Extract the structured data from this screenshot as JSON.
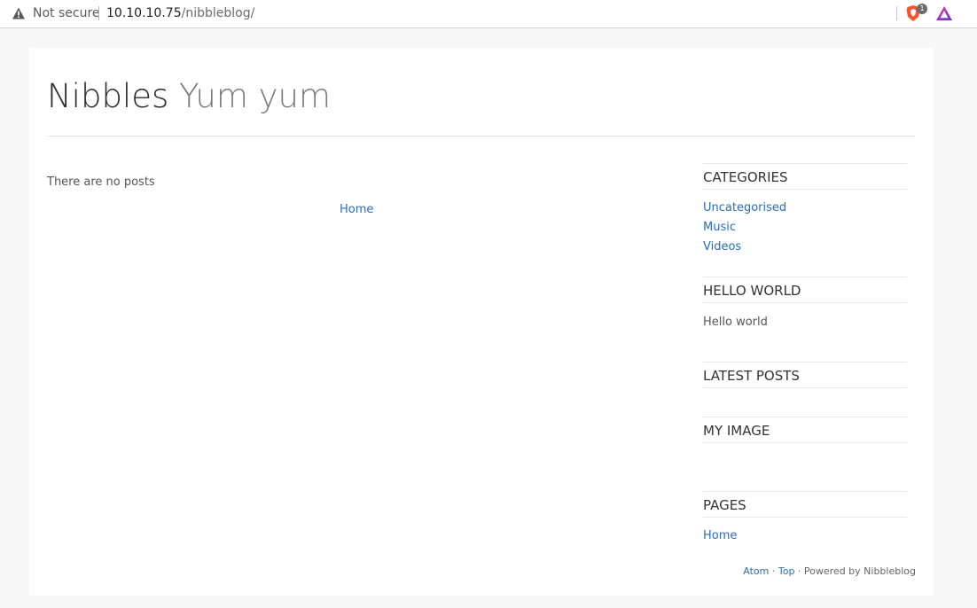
{
  "browser": {
    "security_label": "Not secure",
    "url_host": "10.10.10.75",
    "url_path": "/nibbleblog/",
    "brave_badge_count": "1",
    "icons": [
      "warning-icon",
      "brave-shields-icon",
      "brave-rewards-icon"
    ]
  },
  "blog": {
    "title": "Nibbles",
    "slogan": "Yum yum",
    "no_posts_text": "There are no posts",
    "pager_home": "Home"
  },
  "sidebar": {
    "categories": {
      "title": "CATEGORIES",
      "items": [
        "Uncategorised",
        "Music",
        "Videos"
      ]
    },
    "hello_world": {
      "title": "HELLO WORLD",
      "text": "Hello world"
    },
    "latest_posts": {
      "title": "LATEST POSTS"
    },
    "my_image": {
      "title": "MY IMAGE"
    },
    "pages": {
      "title": "PAGES",
      "items": [
        "Home"
      ]
    }
  },
  "footer": {
    "atom": "Atom",
    "sep1": " · ",
    "top": "Top",
    "powered": " · Powered by Nibbleblog"
  },
  "colors": {
    "link": "#2b6cb5",
    "brave_orange": "#fb542b",
    "page_bg": "#f7f7f7"
  }
}
